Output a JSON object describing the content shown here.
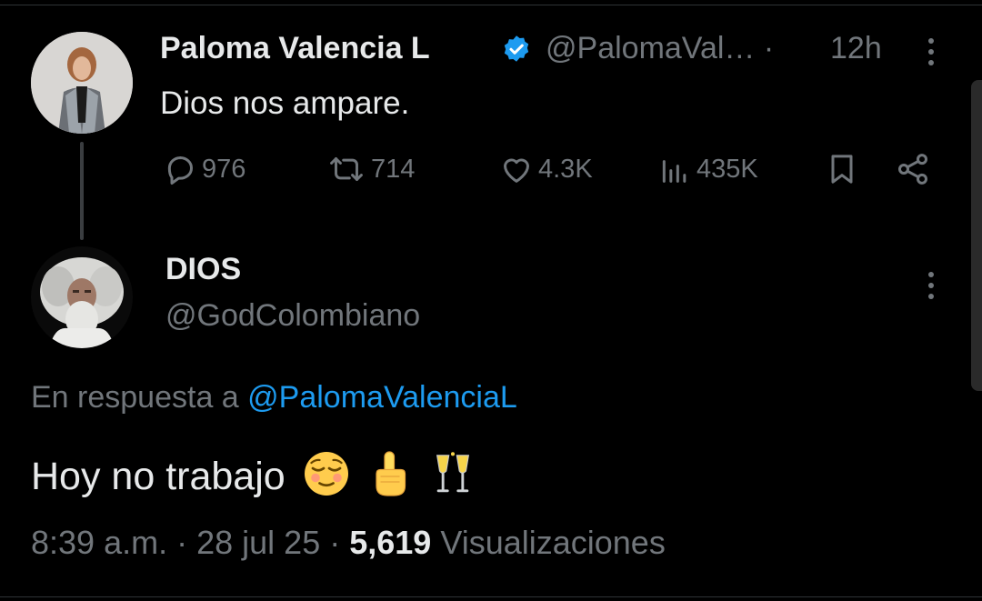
{
  "tweet1": {
    "author_name": "Paloma Valencia L",
    "verified": true,
    "handle": "@PalomaVal…",
    "separator": "·",
    "time": "12h",
    "text": "Dios nos ampare.",
    "stats": {
      "replies": "976",
      "retweets": "714",
      "likes": "4.3K",
      "views": "435K"
    }
  },
  "tweet2": {
    "author_name": "DIOS",
    "handle": "@GodColombiano",
    "reply_prefix": "En respuesta a",
    "reply_to": "@PalomaValenciaL",
    "text": "Hoy no trabajo",
    "emojis": [
      "relieved-face",
      "index-pointing-up",
      "clinking-glasses"
    ],
    "timestamp": "8:39 a.m.",
    "date": "28 jul 25",
    "views_count": "5,619",
    "views_label": "Visualizaciones"
  },
  "colors": {
    "background": "#000000",
    "text_primary": "#e7e9ea",
    "text_secondary": "#71767b",
    "link": "#1d9bf0",
    "verified": "#1d9bf0"
  },
  "icons": [
    "reply-icon",
    "retweet-icon",
    "like-icon",
    "views-icon",
    "bookmark-icon",
    "share-icon",
    "more-icon",
    "verified-badge-icon"
  ]
}
